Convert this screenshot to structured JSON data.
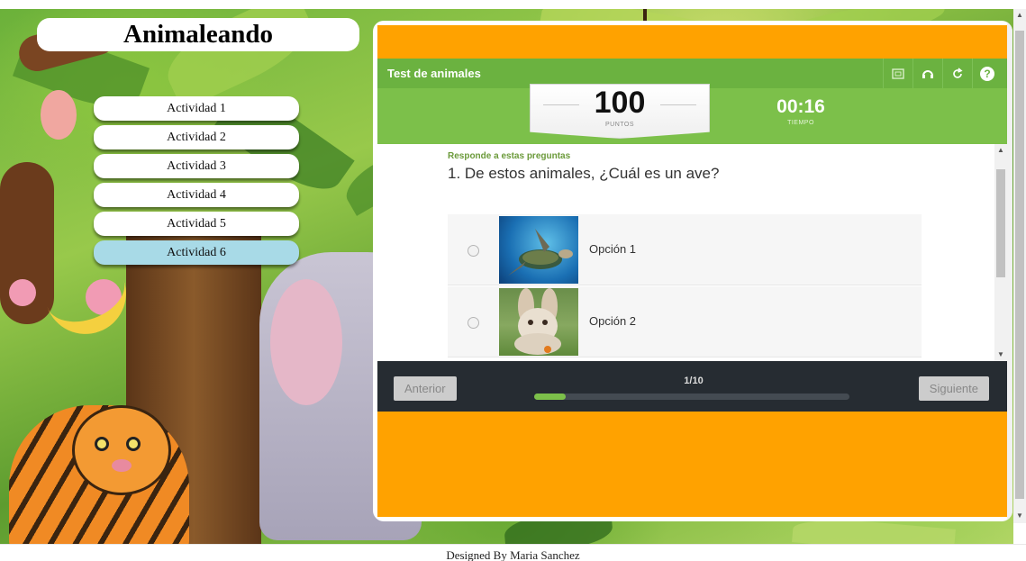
{
  "site": {
    "title": "Animaleando"
  },
  "menu": {
    "items": [
      {
        "label": "Actividad 1",
        "active": false
      },
      {
        "label": "Actividad 2",
        "active": false
      },
      {
        "label": "Actividad 3",
        "active": false
      },
      {
        "label": "Actividad 4",
        "active": false
      },
      {
        "label": "Actividad 5",
        "active": false
      },
      {
        "label": "Actividad 6",
        "active": true
      }
    ]
  },
  "quiz": {
    "title": "Test de animales",
    "tools": [
      "fullscreen-icon",
      "audio-icon",
      "restart-icon",
      "help-icon"
    ],
    "help_glyph": "?",
    "score": {
      "value": "100",
      "label": "PUNTOS"
    },
    "time": {
      "value": "00:16",
      "label": "TIEMPO"
    },
    "instruction": "Responde a estas preguntas",
    "question": "1. De estos animales, ¿Cuál es un ave?",
    "options": [
      {
        "label": "Opción 1",
        "image": "turtle"
      },
      {
        "label": "Opción 2",
        "image": "rabbit"
      }
    ],
    "nav": {
      "prev_label": "Anterior",
      "next_label": "Siguiente",
      "counter": "1/10",
      "progress": 0.1
    }
  },
  "footer": {
    "text": "Designed By Maria Sanchez"
  },
  "colors": {
    "quiz_green": "#6bb240",
    "score_green": "#7cc04a",
    "frame_orange": "#ffa200",
    "nav_dark": "#262c32",
    "active_menu": "#a8dae7"
  }
}
